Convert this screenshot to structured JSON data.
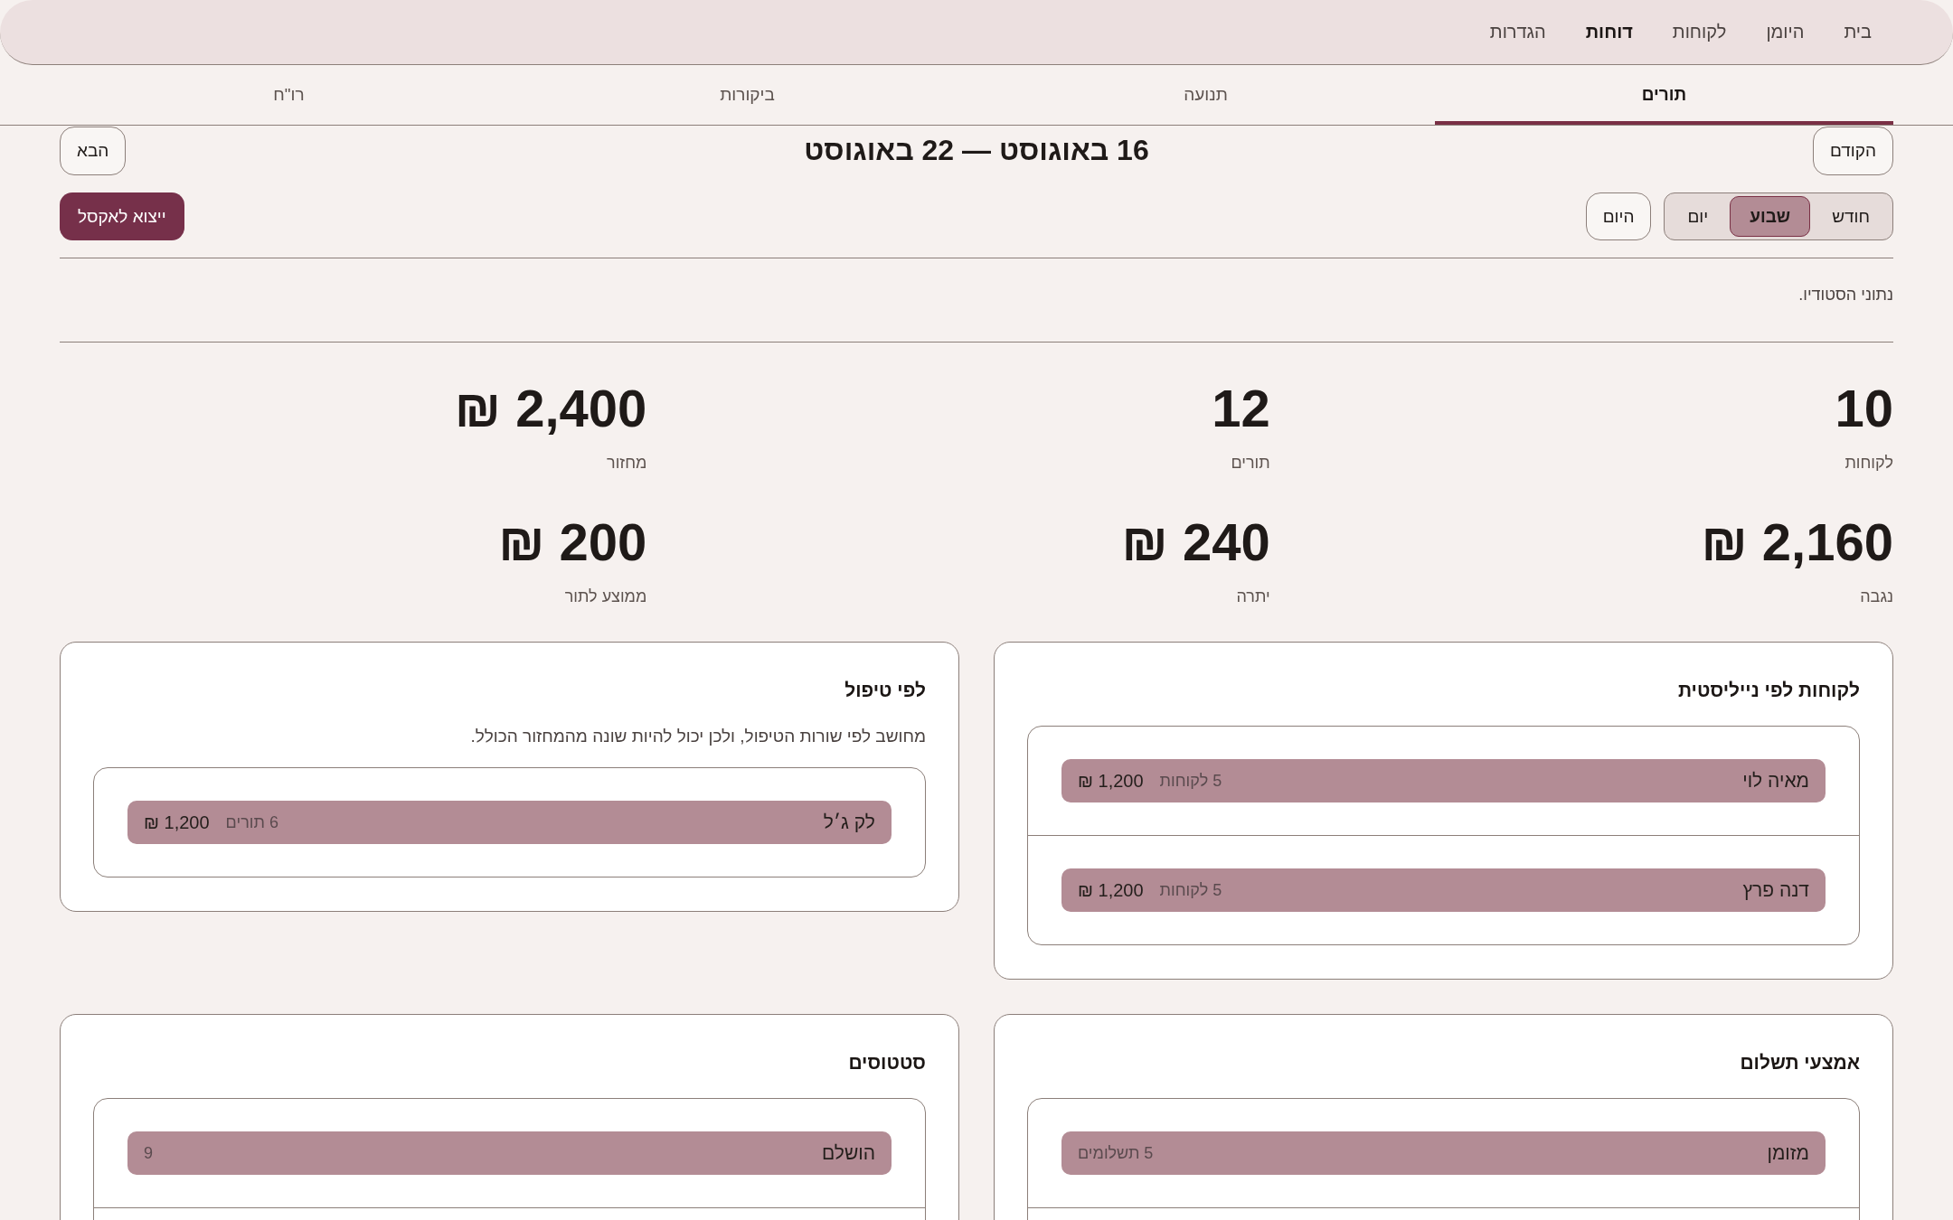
{
  "nav": {
    "items": [
      {
        "label": "בית",
        "selected": false
      },
      {
        "label": "היומן",
        "selected": false
      },
      {
        "label": "לקוחות",
        "selected": false
      },
      {
        "label": "דוחות",
        "selected": true
      },
      {
        "label": "הגדרות",
        "selected": false
      }
    ]
  },
  "tabs": [
    {
      "label": "תורים",
      "selected": true
    },
    {
      "label": "תנועה",
      "selected": false
    },
    {
      "label": "ביקורות",
      "selected": false
    },
    {
      "label": "רו\"ח",
      "selected": false
    }
  ],
  "period": {
    "prev": "הקודם",
    "title": "16 באוגוסט — 22 באוגוסט",
    "next": "הבא"
  },
  "toolbar": {
    "ranges": [
      {
        "label": "חודש",
        "selected": false
      },
      {
        "label": "שבוע",
        "selected": true
      },
      {
        "label": "יום",
        "selected": false
      }
    ],
    "today": "היום",
    "export": "ייצוא לאקסל"
  },
  "note": "נתוני הסטודיו.",
  "stats": [
    {
      "value": "10",
      "label": "לקוחות"
    },
    {
      "value": "12",
      "label": "תורים"
    },
    {
      "value": "2,400 ₪",
      "label": "מחזור"
    },
    {
      "value": "2,160 ₪",
      "label": "נגבה"
    },
    {
      "value": "240 ₪",
      "label": "יתרה"
    },
    {
      "value": "200 ₪",
      "label": "ממוצע לתור"
    }
  ],
  "cards": [
    {
      "title": "לקוחות לפי נייליסטית",
      "rows": [
        {
          "name": "מאיה לוי",
          "count": "5 לקוחות",
          "amount": "1,200 ₪"
        },
        {
          "name": "דנה פרץ",
          "count": "5 לקוחות",
          "amount": "1,200 ₪"
        }
      ]
    },
    {
      "title": "לפי טיפול",
      "description": "מחושב לפי שורות הטיפול, ולכן יכול להיות שונה מהמחזור הכולל.",
      "rows": [
        {
          "name": "לק ג׳ל",
          "count": "6 תורים",
          "amount": "1,200 ₪"
        }
      ]
    },
    {
      "title": "אמצעי תשלום",
      "rows": [
        {
          "name": "מזומן",
          "count": "5 תשלומים"
        }
      ],
      "more_below": true
    },
    {
      "title": "סטטוסים",
      "rows": [
        {
          "name": "הושלם",
          "count": "9"
        }
      ],
      "more_below": true
    }
  ]
}
